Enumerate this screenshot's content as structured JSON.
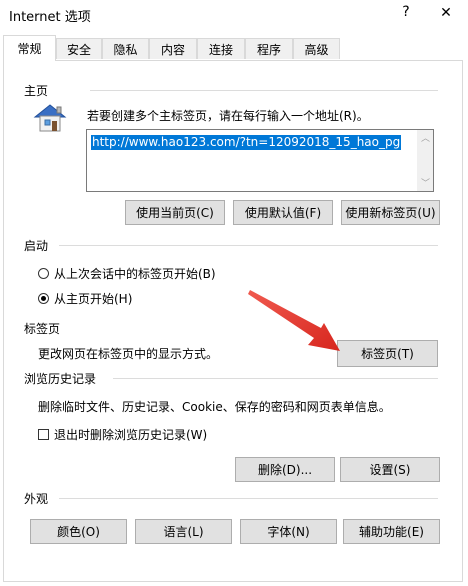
{
  "window": {
    "title": "Internet 选项",
    "help_label": "?",
    "close_label": "✕"
  },
  "tabs": [
    {
      "label": "常规",
      "active": true
    },
    {
      "label": "安全"
    },
    {
      "label": "隐私"
    },
    {
      "label": "内容"
    },
    {
      "label": "连接"
    },
    {
      "label": "程序"
    },
    {
      "label": "高级"
    }
  ],
  "home": {
    "section_label": "主页",
    "icon": "home-page-icon",
    "instructions": "若要创建多个主标签页，请在每行输入一个地址(R)。",
    "url_value": "http://www.hao123.com/?tn=12092018_15_hao_pg",
    "buttons": {
      "use_current": "使用当前页(C)",
      "use_default": "使用默认值(F)",
      "use_new_tab": "使用新标签页(U)"
    }
  },
  "startup": {
    "section_label": "启动",
    "options": [
      {
        "label": "从上次会话中的标签页开始(B)",
        "selected": false
      },
      {
        "label": "从主页开始(H)",
        "selected": true
      }
    ]
  },
  "tabs_section": {
    "section_label": "标签页",
    "description": "更改网页在标签页中的显示方式。",
    "button": "标签页(T)",
    "annotation_arrow_color": "#e8403a"
  },
  "history": {
    "section_label": "浏览历史记录",
    "description": "删除临时文件、历史记录、Cookie、保存的密码和网页表单信息。",
    "checkbox_label": "退出时删除浏览历史记录(W)",
    "checkbox_checked": false,
    "delete_button": "删除(D)...",
    "settings_button": "设置(S)"
  },
  "appearance": {
    "section_label": "外观",
    "buttons": {
      "colors": "颜色(O)",
      "languages": "语言(L)",
      "fonts": "字体(N)",
      "accessibility": "辅助功能(E)"
    }
  },
  "colors": {
    "selection_bg": "#0078d7",
    "button_face": "#e1e1e1",
    "button_border": "#adadad"
  }
}
